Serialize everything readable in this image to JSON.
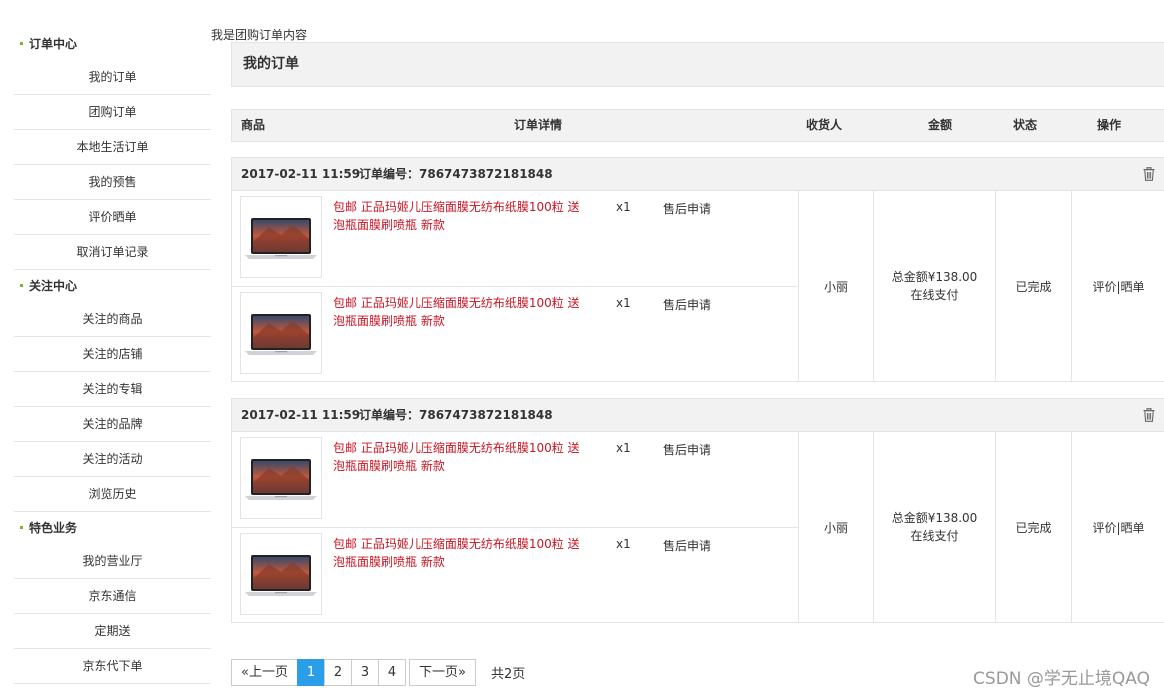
{
  "sidebar": {
    "sections": [
      {
        "title": "订单中心",
        "items": [
          "我的订单",
          "团购订单",
          "本地生活订单",
          "我的预售",
          "评价晒单",
          "取消订单记录"
        ]
      },
      {
        "title": "关注中心",
        "items": [
          "关注的商品",
          "关注的店铺",
          "关注的专辑",
          "关注的品牌",
          "关注的活动",
          "浏览历史"
        ]
      },
      {
        "title": "特色业务",
        "items": [
          "我的营业厅",
          "京东通信",
          "定期送",
          "京东代下单"
        ]
      }
    ]
  },
  "main": {
    "top_note": "我是团购订单内容",
    "header_title": "我的订单",
    "columns": {
      "product": "商品",
      "detail": "订单详情",
      "receiver": "收货人",
      "amount": "金额",
      "status": "状态",
      "ops": "操作"
    },
    "orders": [
      {
        "date": "2017-02-11 11:59",
        "order_no": "订单编号：7867473872181848",
        "items": [
          {
            "title": "包邮 正品玛姬儿压缩面膜无纺布纸膜100粒 送泡瓶面膜刷喷瓶 新款",
            "qty": "x1",
            "aftersale": "售后申请"
          },
          {
            "title": "包邮 正品玛姬儿压缩面膜无纺布纸膜100粒 送泡瓶面膜刷喷瓶 新款",
            "qty": "x1",
            "aftersale": "售后申请"
          }
        ],
        "receiver": "小丽",
        "amount_total": "总金额¥138.00",
        "payment": "在线支付",
        "status": "已完成",
        "ops": "评价|晒单"
      },
      {
        "date": "2017-02-11 11:59",
        "order_no": "订单编号：7867473872181848",
        "items": [
          {
            "title": "包邮 正品玛姬儿压缩面膜无纺布纸膜100粒 送泡瓶面膜刷喷瓶 新款",
            "qty": "x1",
            "aftersale": "售后申请"
          },
          {
            "title": "包邮 正品玛姬儿压缩面膜无纺布纸膜100粒 送泡瓶面膜刷喷瓶 新款",
            "qty": "x1",
            "aftersale": "售后申请"
          }
        ],
        "receiver": "小丽",
        "amount_total": "总金额¥138.00",
        "payment": "在线支付",
        "status": "已完成",
        "ops": "评价|晒单"
      }
    ]
  },
  "pagination": {
    "prev": "«上一页",
    "pages": [
      "1",
      "2",
      "3",
      "4"
    ],
    "current": "1",
    "next": "下一页»",
    "total": "共2页"
  },
  "watermark": "CSDN @学无止境QAQ",
  "colors": {
    "accent_blue": "#2b9ee8",
    "product_red": "#c81623",
    "header_gray": "#f2f2f2",
    "bullet_green": "#7db32b"
  },
  "icons": {
    "trash": "trash-icon",
    "thumbnail": "laptop-thumbnail"
  }
}
